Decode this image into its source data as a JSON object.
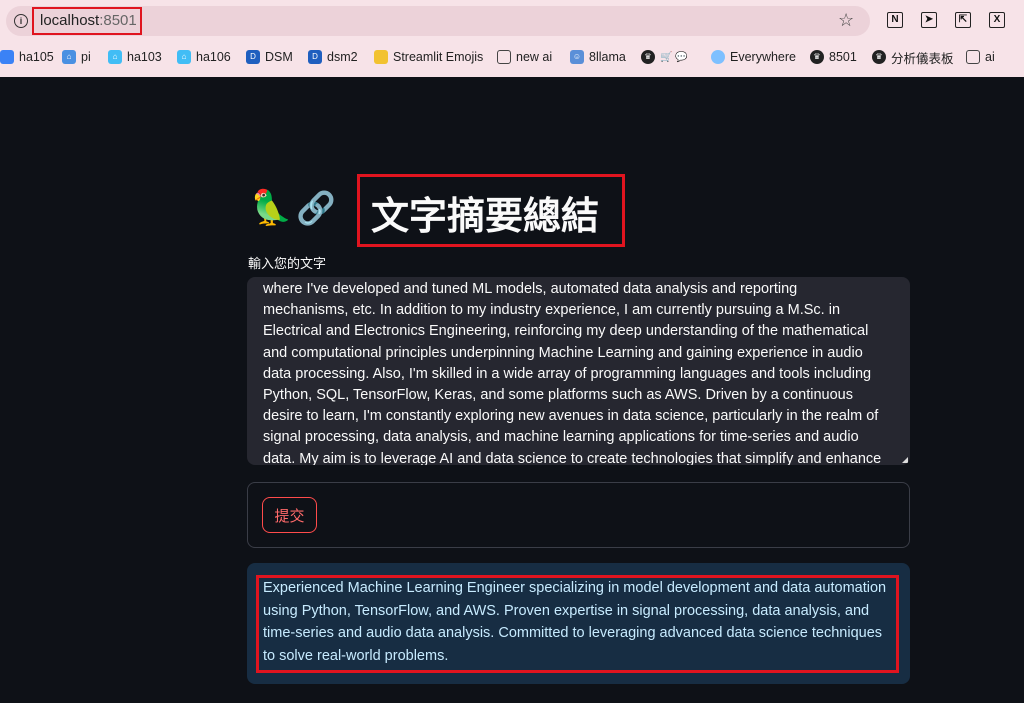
{
  "browser": {
    "url_host": "localhost",
    "url_port": ":8501",
    "bookmarks": [
      {
        "label": "ha105",
        "icon": "folder-blue-icon"
      },
      {
        "label": "pi",
        "icon": "home-icon"
      },
      {
        "label": "ha103",
        "icon": "home-assistant-icon"
      },
      {
        "label": "ha106",
        "icon": "home-assistant-icon"
      },
      {
        "label": "DSM",
        "icon": "dsm-icon"
      },
      {
        "label": "dsm2",
        "icon": "dsm-icon"
      },
      {
        "label": "Streamlit Emojis",
        "icon": "folder-yellow-icon"
      },
      {
        "label": "new ai",
        "icon": "folder-icon"
      },
      {
        "label": "8llama",
        "icon": "llama-icon"
      },
      {
        "label": "",
        "icon": "crown-icon"
      },
      {
        "label": "Everywhere",
        "icon": "chat-bubble-icon"
      },
      {
        "label": "8501",
        "icon": "crown-icon"
      },
      {
        "label": "分析儀表板",
        "icon": "crown-icon"
      },
      {
        "label": "ai",
        "icon": "folder-icon"
      }
    ],
    "extensions": [
      "notion-icon",
      "send-icon",
      "resize-icon",
      "excel-icon"
    ]
  },
  "app": {
    "title_emojis": {
      "parrot": "🦜",
      "link": "🔗"
    },
    "title": "文字摘要總結",
    "input_label": "輸入您的文字",
    "input_text": "where I've developed and tuned ML models, automated data analysis and reporting mechanisms, etc. In addition to my industry experience, I am currently pursuing a M.Sc. in Electrical and Electronics Engineering, reinforcing my deep understanding of the mathematical and computational principles underpinning Machine Learning and gaining experience in audio data processing. Also, I'm skilled in a wide array of programming languages and tools including Python, SQL, TensorFlow, Keras, and some platforms such as AWS. Driven by a continuous desire to learn, I'm constantly exploring new avenues in data science, particularly in the realm of signal processing, data analysis, and machine learning applications for time-series and audio data. My aim is to leverage AI and data science to create technologies that simplify and enhance people's lives.",
    "submit_label": "提交",
    "result_text": "Experienced Machine Learning Engineer specializing in model development and data automation using Python, TensorFlow, and AWS. Proven expertise in signal processing, data analysis, and time-series and audio data analysis. Committed to leveraging advanced data science techniques to solve real-world problems."
  }
}
